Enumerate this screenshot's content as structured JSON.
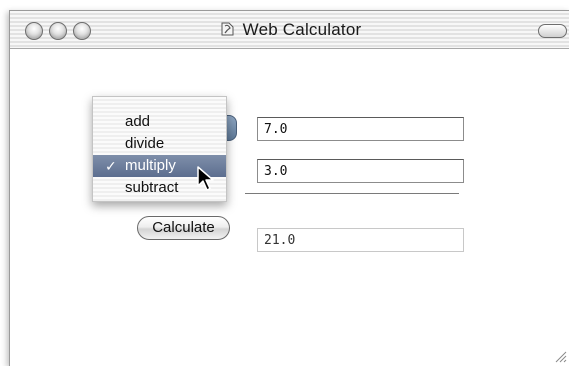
{
  "window": {
    "title": "Web Calculator"
  },
  "operation_menu": {
    "items": [
      "add",
      "divide",
      "multiply",
      "subtract"
    ],
    "selected": "multiply",
    "checkmark": "✓"
  },
  "inputs": {
    "first_value": "7.0",
    "second_value": "3.0"
  },
  "calculate_button": {
    "label": "Calculate"
  },
  "result": {
    "value": "21.0"
  },
  "icons": {
    "title_proxy": "document-proxy-icon",
    "cursor": "arrow-cursor-icon",
    "grow": "resize-grip-icon"
  }
}
